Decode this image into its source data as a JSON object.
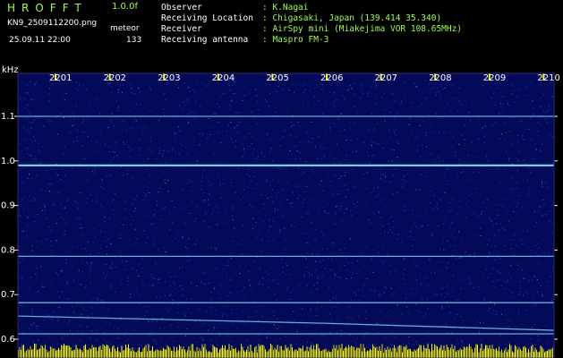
{
  "header": {
    "brand": "HROFFT",
    "version": "1.0.0f",
    "filename": "KN9_2509112200.png",
    "mode": "meteor",
    "datetime": "25.09.11 22:00",
    "count": "133",
    "observer_label": "Observer",
    "observer": ": K.Nagai",
    "location_label": "Receiving Location",
    "location": ": Chigasaki, Japan (139.414 35.340)",
    "receiver_label": "Receiver",
    "receiver": ": AirSpy mini (Miakejima VOR 108.65MHz)",
    "antenna_label": "Receiving antenna",
    "antenna": ": Maspro FM-3"
  },
  "plot": {
    "y_unit": "kHz",
    "y_ticks": [
      "1.1",
      "1.0",
      "0.9",
      "0.8",
      "0.7",
      "0.6"
    ],
    "x_ticks": [
      "2201",
      "2202",
      "2203",
      "2204",
      "2205",
      "2206",
      "2207",
      "2208",
      "2209",
      "2210"
    ],
    "colors": {
      "background": "#040a5a",
      "noise": "#2a50ff",
      "signal": "#7fe8ff",
      "header_text": "#9fff38",
      "meteor_bar": "#ffff00"
    },
    "traces": [
      {
        "name": "carrier-1.1",
        "khz": 1.1
      },
      {
        "name": "carrier-1.0",
        "khz": 0.99
      },
      {
        "name": "carrier-0.78",
        "khz": 0.786
      },
      {
        "name": "carrier-0.68",
        "khz": 0.682
      },
      {
        "name": "drifting-0.65",
        "khz_start": 0.652,
        "khz_end": 0.62
      },
      {
        "name": "carrier-0.61",
        "khz": 0.612
      }
    ]
  }
}
